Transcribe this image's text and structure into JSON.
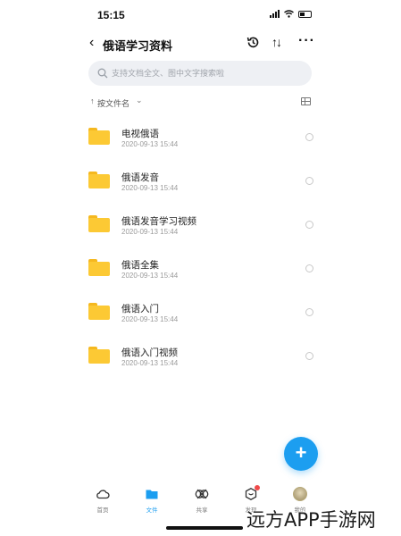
{
  "status_bar": {
    "time": "15:15"
  },
  "nav": {
    "title": "俄语学习资料"
  },
  "search": {
    "placeholder": "支持文档全文、图中文字搜索啦"
  },
  "sort": {
    "label": "按文件名"
  },
  "files": [
    {
      "name": "电视俄语",
      "date": "2020-09-13 15:44"
    },
    {
      "name": "俄语发音",
      "date": "2020-09-13 15:44"
    },
    {
      "name": "俄语发音学习视频",
      "date": "2020-09-13 15:44"
    },
    {
      "name": "俄语全集",
      "date": "2020-09-13 15:44"
    },
    {
      "name": "俄语入门",
      "date": "2020-09-13 15:44"
    },
    {
      "name": "俄语入门视频",
      "date": "2020-09-13 15:44"
    }
  ],
  "tabs": [
    {
      "label": "首页",
      "icon": "cloud-icon"
    },
    {
      "label": "文件",
      "icon": "folder-icon"
    },
    {
      "label": "共享",
      "icon": "share-icon"
    },
    {
      "label": "发现",
      "icon": "discover-icon"
    },
    {
      "label": "我的",
      "icon": "avatar"
    }
  ],
  "active_tab": "文件",
  "colors": {
    "accent": "#1c9ef0",
    "folder": "#fcc934",
    "badge": "#f04a4a"
  },
  "watermark": "远方APP手游网"
}
